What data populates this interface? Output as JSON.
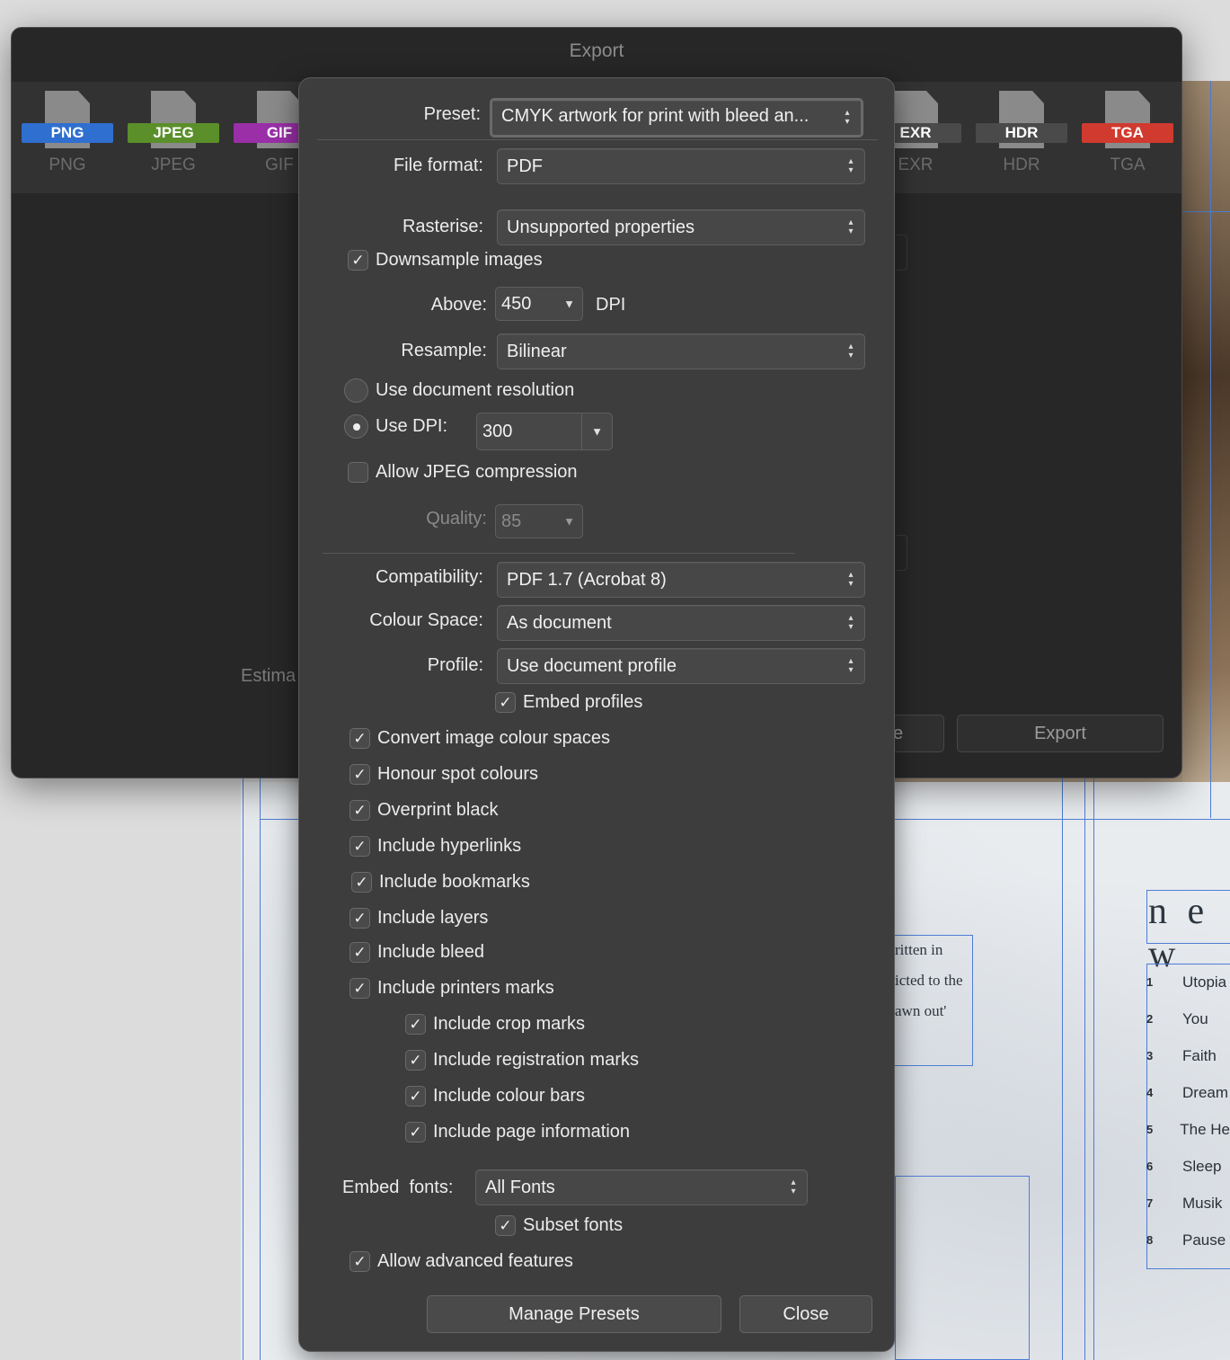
{
  "background": {
    "toc_heading": "n e w",
    "toc": [
      {
        "num": "1",
        "title": "Utopia"
      },
      {
        "num": "2",
        "title": "You"
      },
      {
        "num": "3",
        "title": "Faith"
      },
      {
        "num": "4",
        "title": "Dream"
      },
      {
        "num": "5",
        "title": "The He"
      },
      {
        "num": "6",
        "title": "Sleep"
      },
      {
        "num": "7",
        "title": "Musik"
      },
      {
        "num": "8",
        "title": "Pause"
      }
    ],
    "snippet": [
      "ritten in",
      "icted to the",
      "awn out'"
    ]
  },
  "export_window": {
    "title": "Export",
    "formats": [
      {
        "tag": "PNG",
        "name": "PNG",
        "color": "#2f6fd0"
      },
      {
        "tag": "JPEG",
        "name": "JPEG",
        "color": "#5a8f2a"
      },
      {
        "tag": "GIF",
        "name": "GIF",
        "color": "#9a2fa8"
      },
      {
        "tag": "EXR",
        "name": "EXR",
        "color": "#4a4a4a"
      },
      {
        "tag": "HDR",
        "name": "HDR",
        "color": "#4a4a4a"
      },
      {
        "tag": "TGA",
        "name": "TGA",
        "color": "#d03a2f"
      }
    ],
    "estimate_label": "Estima",
    "more_label": "e",
    "export_label": "Export"
  },
  "pdf_options": {
    "preset": {
      "label": "Preset:",
      "value": "CMYK artwork for print with bleed an..."
    },
    "file_format": {
      "label": "File format:",
      "value": "PDF"
    },
    "rasterise": {
      "label": "Rasterise:",
      "value": "Unsupported properties"
    },
    "downsample": {
      "label": "Downsample images",
      "checked": true
    },
    "above": {
      "label": "Above:",
      "value": "450",
      "unit": "DPI"
    },
    "resample": {
      "label": "Resample:",
      "value": "Bilinear"
    },
    "use_doc_res": {
      "label": "Use document resolution",
      "selected": false
    },
    "use_dpi": {
      "label": "Use DPI:",
      "value": "300",
      "selected": true
    },
    "jpeg_compression": {
      "label": "Allow JPEG compression",
      "checked": false
    },
    "quality": {
      "label": "Quality:",
      "value": "85"
    },
    "compatibility": {
      "label": "Compatibility:",
      "value": "PDF 1.7 (Acrobat 8)"
    },
    "colour_space": {
      "label": "Colour Space:",
      "value": "As document"
    },
    "profile": {
      "label": "Profile:",
      "value": "Use document profile"
    },
    "embed_profiles": {
      "label": "Embed profiles",
      "checked": true
    },
    "options": [
      {
        "label": "Convert image colour spaces",
        "checked": true
      },
      {
        "label": "Honour spot colours",
        "checked": true
      },
      {
        "label": "Overprint black",
        "checked": true
      },
      {
        "label": "Include hyperlinks",
        "checked": true
      },
      {
        "label": "Include bookmarks",
        "checked": true
      },
      {
        "label": "Include layers",
        "checked": true
      },
      {
        "label": "Include bleed",
        "checked": true
      },
      {
        "label": "Include printers marks",
        "checked": true
      }
    ],
    "marks": [
      {
        "label": "Include crop marks",
        "checked": true
      },
      {
        "label": "Include registration marks",
        "checked": true
      },
      {
        "label": "Include colour bars",
        "checked": true
      },
      {
        "label": "Include page information",
        "checked": true
      }
    ],
    "embed_fonts": {
      "label": "Embed  fonts:",
      "value": "All Fonts"
    },
    "subset_fonts": {
      "label": "Subset fonts",
      "checked": true
    },
    "advanced": {
      "label": "Allow advanced features",
      "checked": true
    },
    "manage_presets": "Manage Presets",
    "close": "Close"
  },
  "icons": {
    "check": "✓",
    "up": "▴",
    "down": "▾",
    "drop": "▼"
  }
}
